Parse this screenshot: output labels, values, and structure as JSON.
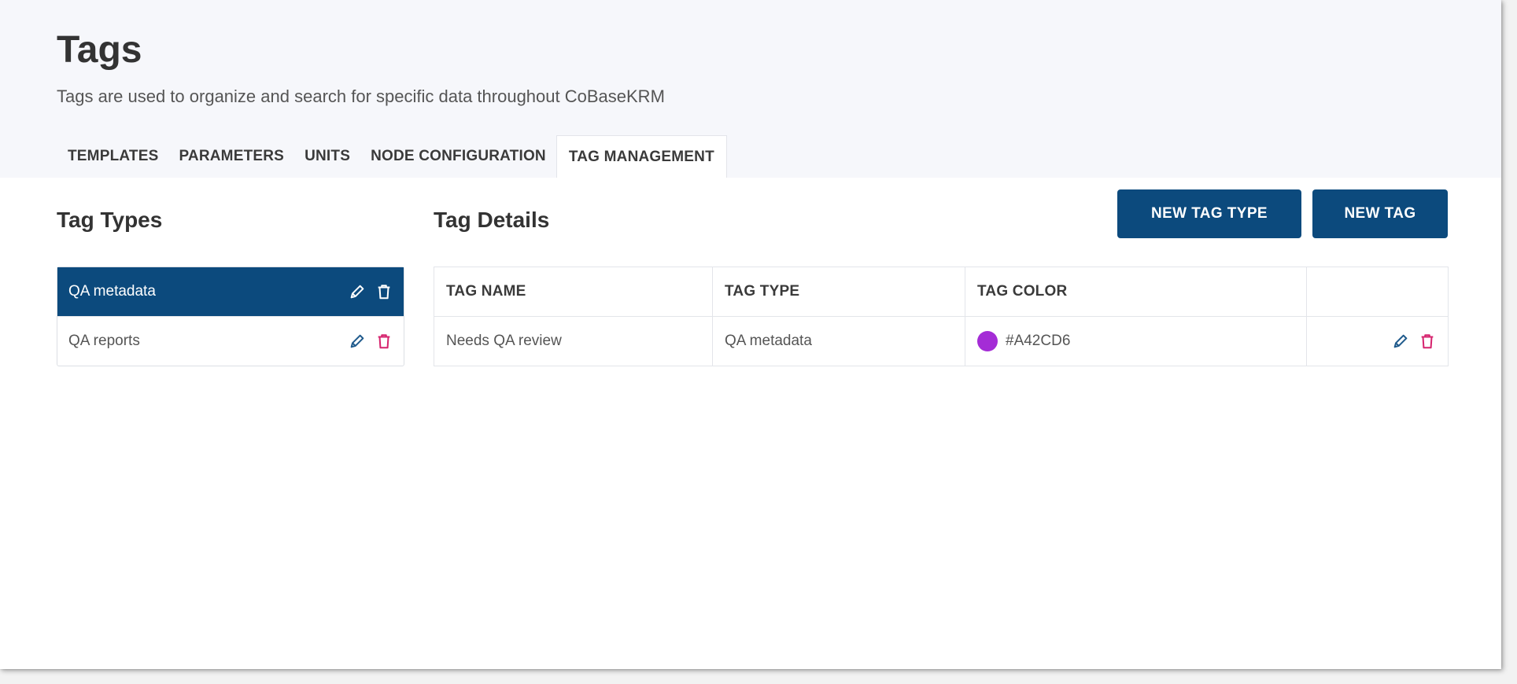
{
  "header": {
    "title": "Tags",
    "subtitle": "Tags are used to organize and search for specific data throughout CoBaseKRM"
  },
  "tabs": [
    {
      "label": "TEMPLATES",
      "active": false
    },
    {
      "label": "PARAMETERS",
      "active": false
    },
    {
      "label": "UNITS",
      "active": false
    },
    {
      "label": "NODE CONFIGURATION",
      "active": false
    },
    {
      "label": "TAG MANAGEMENT",
      "active": true
    }
  ],
  "tag_types": {
    "title": "Tag Types",
    "items": [
      {
        "label": "QA metadata",
        "selected": true,
        "icons": [
          "pencil-icon",
          "trash-icon"
        ]
      },
      {
        "label": "QA reports",
        "selected": false,
        "icons": [
          "pencil-icon",
          "trash-icon"
        ]
      }
    ]
  },
  "tag_details": {
    "title": "Tag Details",
    "buttons": {
      "new_tag_type": "NEW TAG TYPE",
      "new_tag": "NEW TAG"
    },
    "columns": [
      "TAG NAME",
      "TAG TYPE",
      "TAG COLOR",
      ""
    ],
    "rows": [
      {
        "name": "Needs QA review",
        "type": "QA metadata",
        "color": "#A42CD6",
        "icons": [
          "pencil-icon",
          "trash-icon"
        ]
      }
    ]
  },
  "colors": {
    "primary": "#0c4a7d",
    "edit_icon": "#1f5a8c",
    "delete_icon": "#d6246e",
    "header_bg": "#f6f7fb"
  }
}
